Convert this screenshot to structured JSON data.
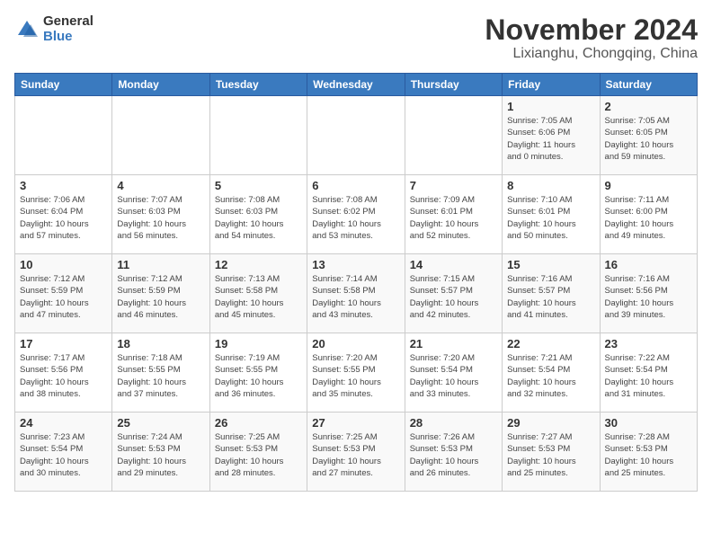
{
  "header": {
    "logo_general": "General",
    "logo_blue": "Blue",
    "month_title": "November 2024",
    "location": "Lixianghu, Chongqing, China"
  },
  "weekdays": [
    "Sunday",
    "Monday",
    "Tuesday",
    "Wednesday",
    "Thursday",
    "Friday",
    "Saturday"
  ],
  "weeks": [
    [
      {
        "day": "",
        "info": ""
      },
      {
        "day": "",
        "info": ""
      },
      {
        "day": "",
        "info": ""
      },
      {
        "day": "",
        "info": ""
      },
      {
        "day": "",
        "info": ""
      },
      {
        "day": "1",
        "info": "Sunrise: 7:05 AM\nSunset: 6:06 PM\nDaylight: 11 hours\nand 0 minutes."
      },
      {
        "day": "2",
        "info": "Sunrise: 7:05 AM\nSunset: 6:05 PM\nDaylight: 10 hours\nand 59 minutes."
      }
    ],
    [
      {
        "day": "3",
        "info": "Sunrise: 7:06 AM\nSunset: 6:04 PM\nDaylight: 10 hours\nand 57 minutes."
      },
      {
        "day": "4",
        "info": "Sunrise: 7:07 AM\nSunset: 6:03 PM\nDaylight: 10 hours\nand 56 minutes."
      },
      {
        "day": "5",
        "info": "Sunrise: 7:08 AM\nSunset: 6:03 PM\nDaylight: 10 hours\nand 54 minutes."
      },
      {
        "day": "6",
        "info": "Sunrise: 7:08 AM\nSunset: 6:02 PM\nDaylight: 10 hours\nand 53 minutes."
      },
      {
        "day": "7",
        "info": "Sunrise: 7:09 AM\nSunset: 6:01 PM\nDaylight: 10 hours\nand 52 minutes."
      },
      {
        "day": "8",
        "info": "Sunrise: 7:10 AM\nSunset: 6:01 PM\nDaylight: 10 hours\nand 50 minutes."
      },
      {
        "day": "9",
        "info": "Sunrise: 7:11 AM\nSunset: 6:00 PM\nDaylight: 10 hours\nand 49 minutes."
      }
    ],
    [
      {
        "day": "10",
        "info": "Sunrise: 7:12 AM\nSunset: 5:59 PM\nDaylight: 10 hours\nand 47 minutes."
      },
      {
        "day": "11",
        "info": "Sunrise: 7:12 AM\nSunset: 5:59 PM\nDaylight: 10 hours\nand 46 minutes."
      },
      {
        "day": "12",
        "info": "Sunrise: 7:13 AM\nSunset: 5:58 PM\nDaylight: 10 hours\nand 45 minutes."
      },
      {
        "day": "13",
        "info": "Sunrise: 7:14 AM\nSunset: 5:58 PM\nDaylight: 10 hours\nand 43 minutes."
      },
      {
        "day": "14",
        "info": "Sunrise: 7:15 AM\nSunset: 5:57 PM\nDaylight: 10 hours\nand 42 minutes."
      },
      {
        "day": "15",
        "info": "Sunrise: 7:16 AM\nSunset: 5:57 PM\nDaylight: 10 hours\nand 41 minutes."
      },
      {
        "day": "16",
        "info": "Sunrise: 7:16 AM\nSunset: 5:56 PM\nDaylight: 10 hours\nand 39 minutes."
      }
    ],
    [
      {
        "day": "17",
        "info": "Sunrise: 7:17 AM\nSunset: 5:56 PM\nDaylight: 10 hours\nand 38 minutes."
      },
      {
        "day": "18",
        "info": "Sunrise: 7:18 AM\nSunset: 5:55 PM\nDaylight: 10 hours\nand 37 minutes."
      },
      {
        "day": "19",
        "info": "Sunrise: 7:19 AM\nSunset: 5:55 PM\nDaylight: 10 hours\nand 36 minutes."
      },
      {
        "day": "20",
        "info": "Sunrise: 7:20 AM\nSunset: 5:55 PM\nDaylight: 10 hours\nand 35 minutes."
      },
      {
        "day": "21",
        "info": "Sunrise: 7:20 AM\nSunset: 5:54 PM\nDaylight: 10 hours\nand 33 minutes."
      },
      {
        "day": "22",
        "info": "Sunrise: 7:21 AM\nSunset: 5:54 PM\nDaylight: 10 hours\nand 32 minutes."
      },
      {
        "day": "23",
        "info": "Sunrise: 7:22 AM\nSunset: 5:54 PM\nDaylight: 10 hours\nand 31 minutes."
      }
    ],
    [
      {
        "day": "24",
        "info": "Sunrise: 7:23 AM\nSunset: 5:54 PM\nDaylight: 10 hours\nand 30 minutes."
      },
      {
        "day": "25",
        "info": "Sunrise: 7:24 AM\nSunset: 5:53 PM\nDaylight: 10 hours\nand 29 minutes."
      },
      {
        "day": "26",
        "info": "Sunrise: 7:25 AM\nSunset: 5:53 PM\nDaylight: 10 hours\nand 28 minutes."
      },
      {
        "day": "27",
        "info": "Sunrise: 7:25 AM\nSunset: 5:53 PM\nDaylight: 10 hours\nand 27 minutes."
      },
      {
        "day": "28",
        "info": "Sunrise: 7:26 AM\nSunset: 5:53 PM\nDaylight: 10 hours\nand 26 minutes."
      },
      {
        "day": "29",
        "info": "Sunrise: 7:27 AM\nSunset: 5:53 PM\nDaylight: 10 hours\nand 25 minutes."
      },
      {
        "day": "30",
        "info": "Sunrise: 7:28 AM\nSunset: 5:53 PM\nDaylight: 10 hours\nand 25 minutes."
      }
    ]
  ]
}
